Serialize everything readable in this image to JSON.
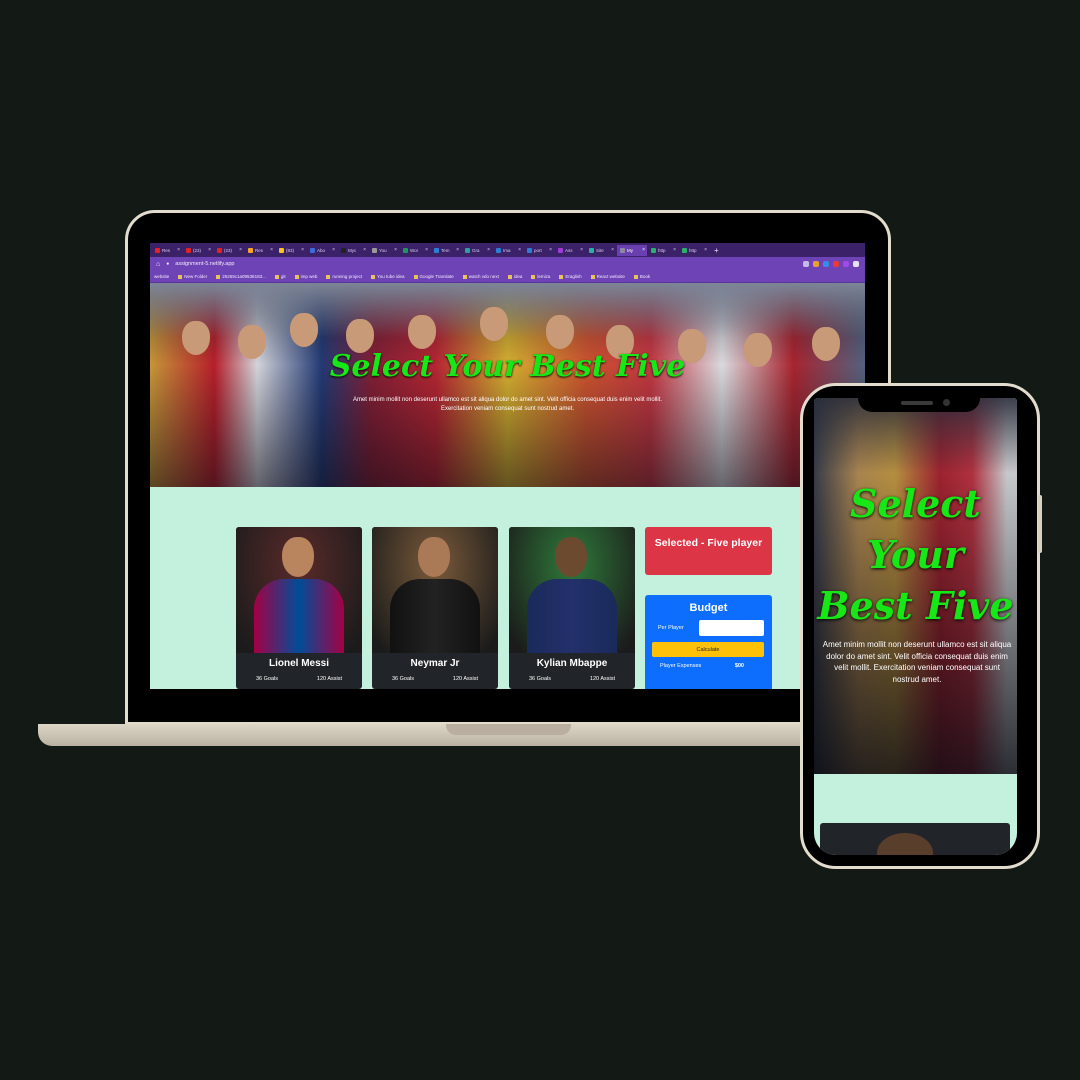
{
  "browser": {
    "tabs": [
      {
        "label": "Res",
        "color": "#e02424"
      },
      {
        "label": "(23)",
        "color": "#e02424"
      },
      {
        "label": "(23)",
        "color": "#e02424"
      },
      {
        "label": "Res",
        "color": "#f5a623"
      },
      {
        "label": "(83)",
        "color": "#f5c518"
      },
      {
        "label": "Abo",
        "color": "#3a6bd6"
      },
      {
        "label": "Myc",
        "color": "#222222"
      },
      {
        "label": "You",
        "color": "#9a9a9a"
      },
      {
        "label": "Wor",
        "color": "#1a9a5a"
      },
      {
        "label": "Tem",
        "color": "#2a7fd4"
      },
      {
        "label": "Gra",
        "color": "#2aa0a0"
      },
      {
        "label": "Ima",
        "color": "#2a7fd4"
      },
      {
        "label": "port",
        "color": "#2a7fd4"
      },
      {
        "label": "Ass",
        "color": "#a03ad4"
      },
      {
        "label": "Site",
        "color": "#2ab0a0"
      },
      {
        "label": "My",
        "color": "#8a8aa0",
        "active": true
      },
      {
        "label": "http",
        "color": "#2ab06a"
      },
      {
        "label": "http",
        "color": "#2ab06a"
      }
    ],
    "new_tab": "+",
    "url": "assignment-5.netlify.app",
    "bookmarks": [
      "website",
      "New Folder",
      "26269c1a09538183...",
      "git",
      "imp web",
      "running project",
      "You tube idea",
      "Google Translate",
      "watch vdo next",
      "idea",
      "lemiza",
      "Eraglish",
      "React website",
      "Book"
    ]
  },
  "hero": {
    "title": "Select Your Best Five",
    "text": "Amet minim mollit non deserunt ullamco est sit aliqua dolor do amet sint. Velit officia consequat duis enim velit mollit. Exercitation veniam consequat sunt nostrud amet."
  },
  "players": [
    {
      "name": "Lionel Messi",
      "goals": "36 Goals",
      "assist": "120 Assist",
      "kit": "#a50044",
      "kit2": "#004d98",
      "skin": "#b9855e",
      "bg": "#5a2a2a"
    },
    {
      "name": "Neymar Jr",
      "goals": "36 Goals",
      "assist": "120 Assist",
      "kit": "#111111",
      "kit2": "#222222",
      "skin": "#a97a55",
      "bg": "#7a5a3a"
    },
    {
      "name": "Kylian Mbappe",
      "goals": "36 Goals",
      "assist": "120 Assist",
      "kit": "#1a2a5a",
      "kit2": "#23306b",
      "skin": "#6b4a30",
      "bg": "#2f7a3a"
    }
  ],
  "selected": {
    "label": "Selected - Five player"
  },
  "budget": {
    "title": "Budget",
    "per_player_label": "Per Player",
    "per_player_value": "",
    "calculate_label": "Calculate",
    "expenses_label": "Player Expenses",
    "expenses_value": "$00"
  },
  "colors": {
    "title_green": "#17e617",
    "page_bg": "#c3f1de",
    "card_bg": "#212529",
    "selected_red": "#dc3545",
    "budget_blue": "#0d6efd",
    "calc_yellow": "#ffc107"
  }
}
